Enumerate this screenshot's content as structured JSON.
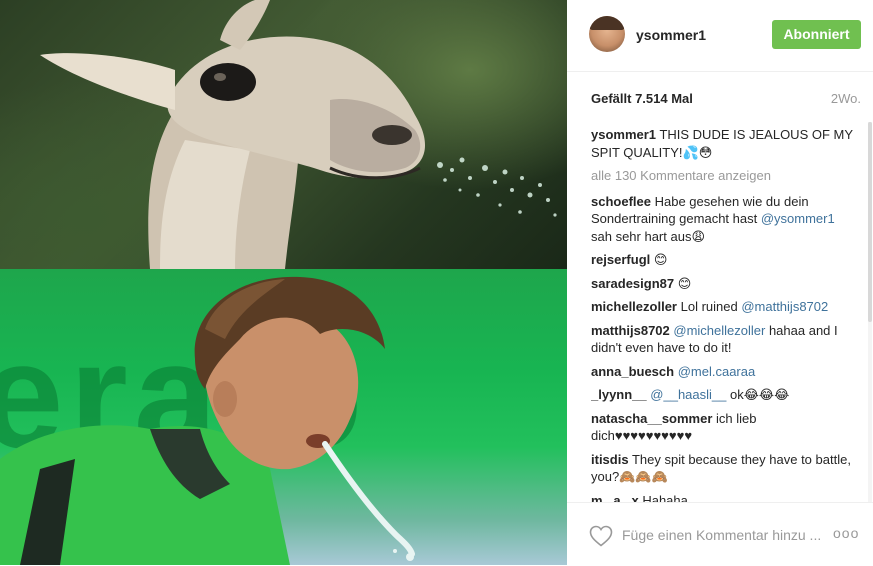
{
  "post": {
    "username": "ysommer1",
    "follow_label": "Abonniert",
    "likes": "Gefällt 7.514 Mal",
    "time": "2Wo.",
    "caption": {
      "user": "ysommer1",
      "text": "THIS DUDE IS JEALOUS OF MY SPIT QUALITY!💦😳"
    },
    "load_more": "alle 130 Kommentare anzeigen",
    "comments": [
      {
        "user": "schoeflee",
        "before": "Habe gesehen wie du dein Sondertraining gemacht hast ",
        "mention": "@ysommer1",
        "after": " sah sehr hart aus😩"
      },
      {
        "user": "rejserfugl",
        "before": "😊",
        "mention": "",
        "after": ""
      },
      {
        "user": "saradesign87",
        "before": "😊",
        "mention": "",
        "after": ""
      },
      {
        "user": "michellezoller",
        "before": "Lol ruined ",
        "mention": "@matthijs8702",
        "after": ""
      },
      {
        "user": "matthijs8702",
        "before": "",
        "mention": "@michellezoller",
        "after": " hahaa and I didn't even have to do it!"
      },
      {
        "user": "anna_buesch",
        "before": "",
        "mention": "@mel.caaraa",
        "after": ""
      },
      {
        "user": "_lyynn__",
        "before": "",
        "mention": "@__haasli__",
        "after": " ok😂😂😂"
      },
      {
        "user": "natascha__sommer",
        "before": "ich lieb dich♥♥♥♥♥♥♥♥♥♥",
        "mention": "",
        "after": ""
      },
      {
        "user": "itisdis",
        "before": "They spit because they have to battle, you?🙈🙈🙈",
        "mention": "",
        "after": ""
      },
      {
        "user": "m. .a. .x",
        "before": "Hahaha",
        "mention": "",
        "after": ""
      }
    ],
    "add_comment_placeholder": "Füge einen Kommentar hinzu ...",
    "more_label": "ooo"
  },
  "photo": {
    "top_panel": "llama",
    "bottom_panel": "player",
    "bg_text": "eralo"
  },
  "icons": {
    "heart": "heart-icon",
    "more": "more-options-icon"
  },
  "colors": {
    "accent": "#70c050",
    "mention": "#3f729b",
    "muted": "#999999",
    "jersey_green": "#1ea64c"
  }
}
